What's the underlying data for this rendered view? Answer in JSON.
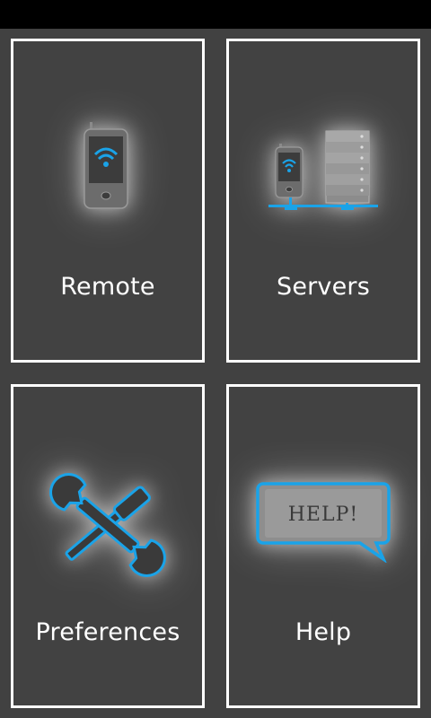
{
  "tiles": {
    "remote": {
      "label": "Remote",
      "icon": "phone-wifi-icon"
    },
    "servers": {
      "label": "Servers",
      "icon": "servers-network-icon"
    },
    "preferences": {
      "label": "Preferences",
      "icon": "wrench-screwdriver-icon"
    },
    "help": {
      "label": "Help",
      "icon": "help-speech-bubble-icon",
      "bubble_text": "HELP!"
    }
  },
  "colors": {
    "background": "#414141",
    "tile_border": "#ffffff",
    "accent": "#1aa3e8",
    "status_bar": "#000000"
  }
}
